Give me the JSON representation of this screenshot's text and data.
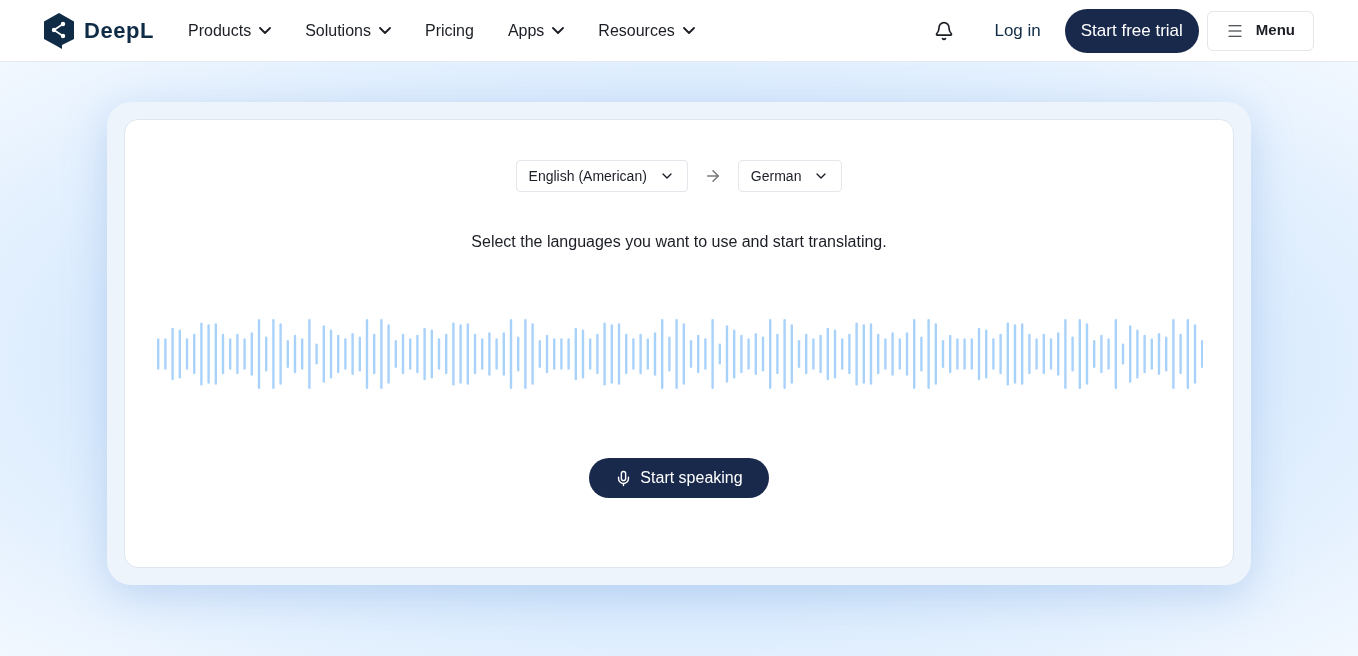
{
  "header": {
    "logo_text": "DeepL",
    "nav": [
      {
        "label": "Products",
        "dropdown": true
      },
      {
        "label": "Solutions",
        "dropdown": true
      },
      {
        "label": "Pricing",
        "dropdown": false
      },
      {
        "label": "Apps",
        "dropdown": true
      },
      {
        "label": "Resources",
        "dropdown": true
      }
    ],
    "login": "Log in",
    "trial_button": "Start free trial",
    "menu_button": "Menu"
  },
  "translator": {
    "source_language": "English (American)",
    "target_language": "German",
    "instruction": "Select the languages you want to use and start translating.",
    "speak_button": "Start speaking"
  }
}
